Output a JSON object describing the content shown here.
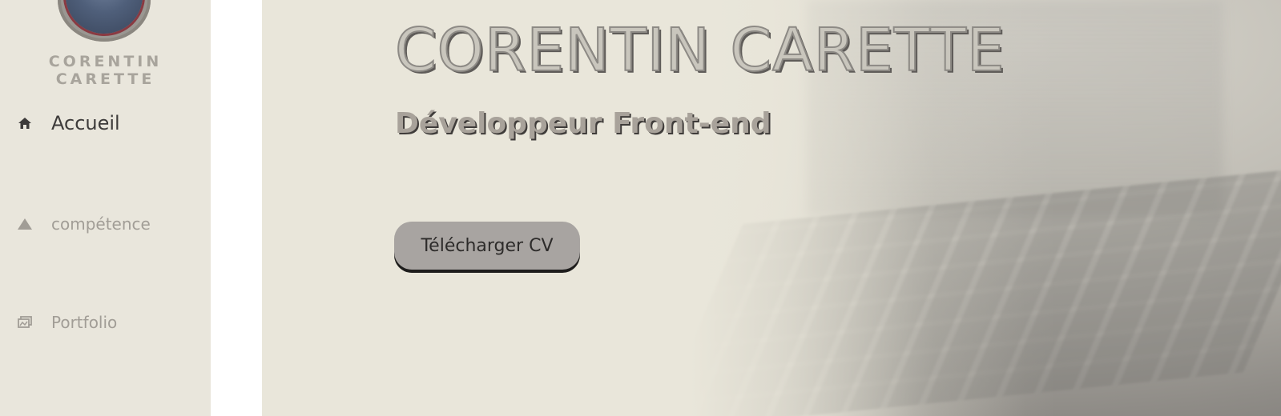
{
  "sidebar": {
    "brand": "CORENTIN CARETTE",
    "items": [
      {
        "label": "Accueil",
        "icon": "home-icon"
      },
      {
        "label": "compétence",
        "icon": "triangle-icon"
      },
      {
        "label": "Portfolio",
        "icon": "images-icon"
      }
    ]
  },
  "hero": {
    "title": "CORENTIN CARETTE",
    "subtitle": "Développeur Front-end",
    "button_label": "Télécharger CV"
  },
  "colors": {
    "sidebar_bg": "#e9e6dc",
    "hero_bg": "#e9e6da",
    "button_bg": "#a8a4a1",
    "active_text": "#3d3b3a",
    "muted_text": "#a19d96"
  }
}
